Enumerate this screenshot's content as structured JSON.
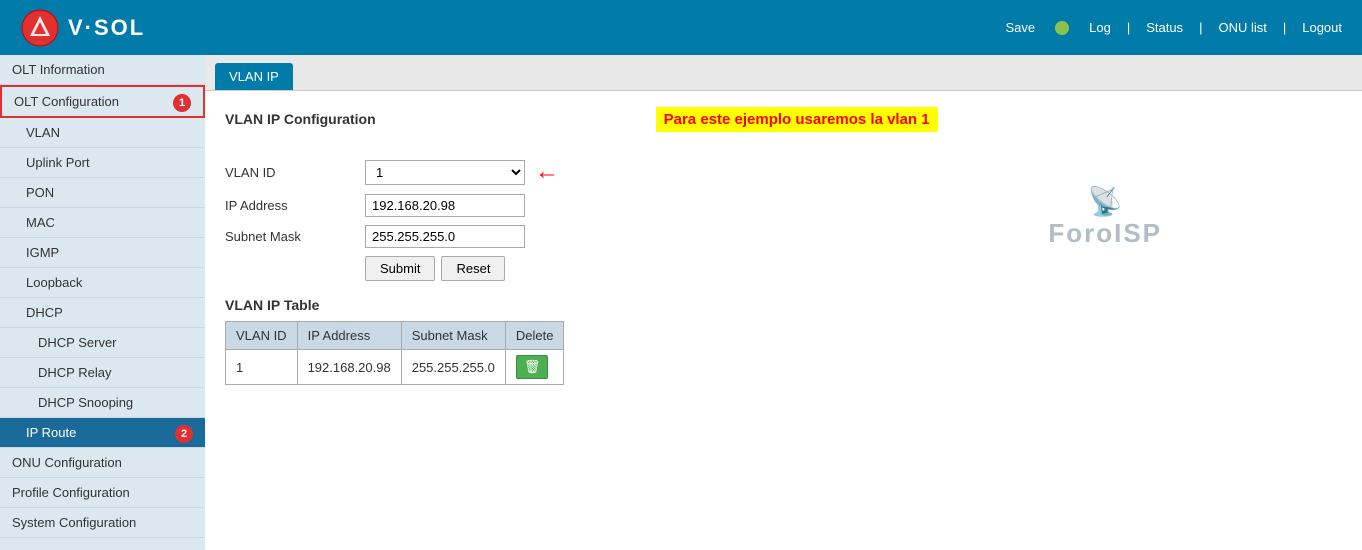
{
  "header": {
    "logo_text": "V·SOL",
    "save_label": "Save",
    "status_color": "#8bc34a",
    "nav": {
      "log": "Log",
      "status": "Status",
      "onu_list": "ONU list",
      "logout": "Logout"
    }
  },
  "sidebar": {
    "items": [
      {
        "id": "olt-information",
        "label": "OLT Information",
        "level": 0,
        "active": false,
        "highlighted": false
      },
      {
        "id": "olt-configuration",
        "label": "OLT Configuration",
        "level": 0,
        "active": false,
        "highlighted": true,
        "badge": "1"
      },
      {
        "id": "vlan",
        "label": "VLAN",
        "level": 1,
        "active": false,
        "highlighted": false
      },
      {
        "id": "uplink-port",
        "label": "Uplink Port",
        "level": 1,
        "active": false,
        "highlighted": false
      },
      {
        "id": "pon",
        "label": "PON",
        "level": 1,
        "active": false,
        "highlighted": false
      },
      {
        "id": "mac",
        "label": "MAC",
        "level": 1,
        "active": false,
        "highlighted": false
      },
      {
        "id": "igmp",
        "label": "IGMP",
        "level": 1,
        "active": false,
        "highlighted": false
      },
      {
        "id": "loopback",
        "label": "Loopback",
        "level": 1,
        "active": false,
        "highlighted": false
      },
      {
        "id": "dhcp",
        "label": "DHCP",
        "level": 1,
        "active": false,
        "highlighted": false
      },
      {
        "id": "dhcp-server",
        "label": "DHCP Server",
        "level": 2,
        "active": false,
        "highlighted": false
      },
      {
        "id": "dhcp-relay",
        "label": "DHCP Relay",
        "level": 2,
        "active": false,
        "highlighted": false
      },
      {
        "id": "dhcp-snooping",
        "label": "DHCP Snooping",
        "level": 2,
        "active": false,
        "highlighted": false
      },
      {
        "id": "ip-route",
        "label": "IP Route",
        "level": 1,
        "active": true,
        "highlighted": true,
        "badge": "2"
      },
      {
        "id": "onu-configuration",
        "label": "ONU Configuration",
        "level": 0,
        "active": false,
        "highlighted": false
      },
      {
        "id": "profile-configuration",
        "label": "Profile Configuration",
        "level": 0,
        "active": false,
        "highlighted": false
      },
      {
        "id": "system-configuration",
        "label": "System Configuration",
        "level": 0,
        "active": false,
        "highlighted": false
      }
    ]
  },
  "tab": {
    "label": "VLAN IP"
  },
  "annotation": "Para este ejemplo usaremos la vlan 1",
  "form": {
    "title": "VLAN IP Configuration",
    "vlan_id_label": "VLAN ID",
    "vlan_id_value": "1",
    "ip_address_label": "IP Address",
    "ip_address_value": "192.168.20.98",
    "subnet_mask_label": "Subnet Mask",
    "subnet_mask_value": "255.255.255.0",
    "submit_label": "Submit",
    "reset_label": "Reset"
  },
  "table": {
    "title": "VLAN IP Table",
    "columns": [
      "VLAN ID",
      "IP Address",
      "Subnet Mask",
      "Delete"
    ],
    "rows": [
      {
        "vlan_id": "1",
        "ip_address": "192.168.20.98",
        "subnet_mask": "255.255.255.0"
      }
    ]
  },
  "watermark": {
    "antenna": "📡",
    "text": "ForoISP"
  }
}
